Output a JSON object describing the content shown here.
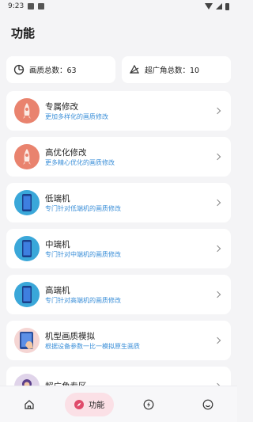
{
  "status": {
    "time": "9:23"
  },
  "page": {
    "title": "功能"
  },
  "stats": {
    "quality_total": "画质总数：63",
    "wide_total": "超广角总数：10"
  },
  "features": [
    {
      "title": "专属修改",
      "subtitle": "更加多样化的画质修改",
      "icon": "rocket-icon"
    },
    {
      "title": "高优化修改",
      "subtitle": "更多精心优化的画质修改",
      "icon": "rocket-icon"
    },
    {
      "title": "低端机",
      "subtitle": "专门针对低端机的画质修改",
      "icon": "phone-icon"
    },
    {
      "title": "中端机",
      "subtitle": "专门针对中端机的画质修改",
      "icon": "phone-icon"
    },
    {
      "title": "高端机",
      "subtitle": "专门针对高端机的画质修改",
      "icon": "phone-icon"
    },
    {
      "title": "机型画质模拟",
      "subtitle": "根据设备参数一比一模拟原生画质",
      "icon": "tablet-touch-icon"
    },
    {
      "title": "超广角专区",
      "subtitle": "",
      "icon": "avatar-icon"
    }
  ],
  "nav": {
    "active_label": "功能"
  },
  "colors": {
    "accent_blue": "#3b8fd8",
    "active_pill": "#fbe0e6",
    "rocket_bg": "#e9836e",
    "phone_bg": "#3aa7d9"
  }
}
